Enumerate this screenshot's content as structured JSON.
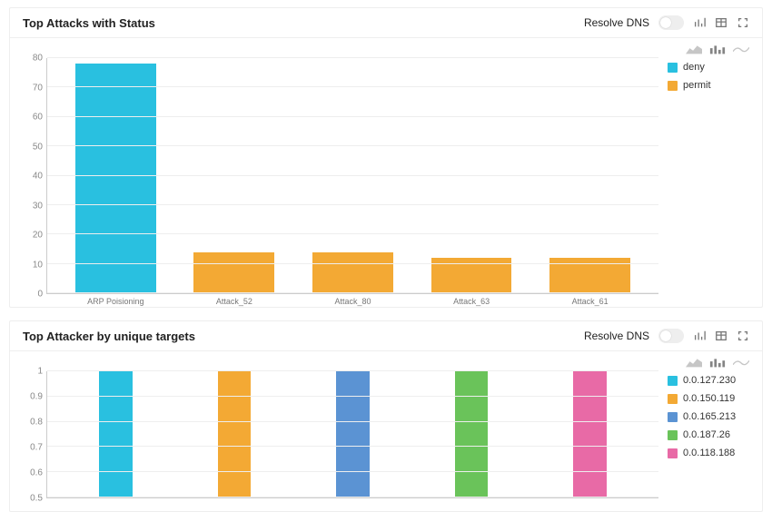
{
  "panel1": {
    "title": "Top Attacks with Status",
    "resolve_label": "Resolve DNS"
  },
  "panel2": {
    "title": "Top Attacker by unique targets",
    "resolve_label": "Resolve DNS"
  },
  "colors": {
    "deny": "#29c0e0",
    "permit": "#f3a934",
    "ip0": "#29c0e0",
    "ip1": "#f3a934",
    "ip2": "#5b93d3",
    "ip3": "#6ac35a",
    "ip4": "#e86aa6"
  },
  "chart_data": [
    {
      "id": "chart1",
      "type": "bar",
      "title": "Top Attacks with Status",
      "xlabel": "",
      "ylabel": "",
      "ylim": [
        0,
        80
      ],
      "yticks": [
        0,
        10,
        20,
        30,
        40,
        50,
        60,
        70,
        80
      ],
      "categories": [
        "ARP Poisioning",
        "Attack_52",
        "Attack_80",
        "Attack_63",
        "Attack_61"
      ],
      "series": [
        {
          "name": "deny",
          "color_key": "deny",
          "values": [
            78,
            null,
            null,
            null,
            null
          ]
        },
        {
          "name": "permit",
          "color_key": "permit",
          "values": [
            null,
            14,
            14,
            12,
            12
          ]
        }
      ],
      "legend": [
        {
          "label": "deny",
          "color_key": "deny"
        },
        {
          "label": "permit",
          "color_key": "permit"
        }
      ]
    },
    {
      "id": "chart2",
      "type": "bar",
      "title": "Top Attacker by unique targets",
      "xlabel": "",
      "ylabel": "",
      "ylim": [
        0.5,
        1
      ],
      "yticks": [
        0.5,
        0.6,
        0.7,
        0.8,
        0.9,
        1
      ],
      "categories": [
        "0.0.127.230",
        "0.0.150.119",
        "0.0.165.213",
        "0.0.187.26",
        "0.0.118.188"
      ],
      "series": [
        {
          "name": "0.0.127.230",
          "color_key": "ip0",
          "values": [
            1,
            null,
            null,
            null,
            null
          ]
        },
        {
          "name": "0.0.150.119",
          "color_key": "ip1",
          "values": [
            null,
            1,
            null,
            null,
            null
          ]
        },
        {
          "name": "0.0.165.213",
          "color_key": "ip2",
          "values": [
            null,
            null,
            1,
            null,
            null
          ]
        },
        {
          "name": "0.0.187.26",
          "color_key": "ip3",
          "values": [
            null,
            null,
            null,
            1,
            null
          ]
        },
        {
          "name": "0.0.118.188",
          "color_key": "ip4",
          "values": [
            null,
            null,
            null,
            null,
            1
          ]
        }
      ],
      "legend": [
        {
          "label": "0.0.127.230",
          "color_key": "ip0"
        },
        {
          "label": "0.0.150.119",
          "color_key": "ip1"
        },
        {
          "label": "0.0.165.213",
          "color_key": "ip2"
        },
        {
          "label": "0.0.187.26",
          "color_key": "ip3"
        },
        {
          "label": "0.0.118.188",
          "color_key": "ip4"
        }
      ]
    }
  ]
}
